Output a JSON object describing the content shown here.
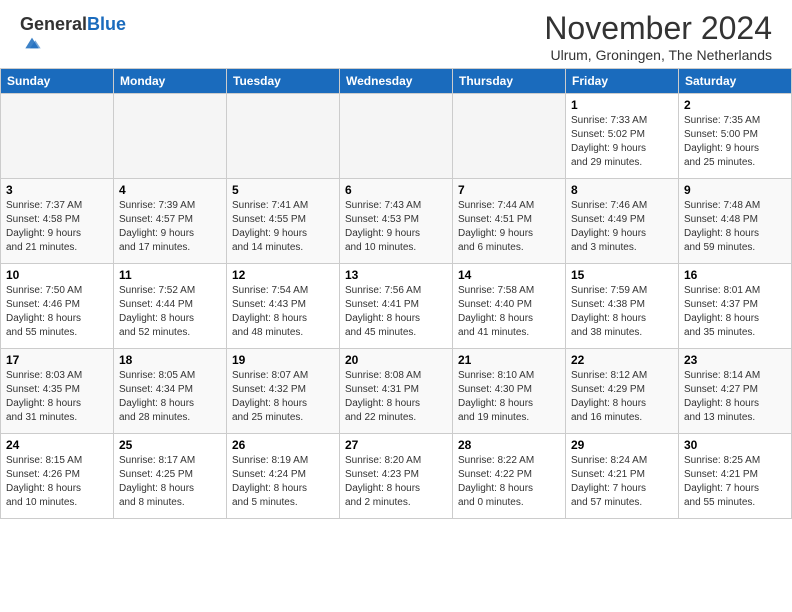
{
  "header": {
    "logo_general": "General",
    "logo_blue": "Blue",
    "month_title": "November 2024",
    "subtitle": "Ulrum, Groningen, The Netherlands"
  },
  "calendar": {
    "days_of_week": [
      "Sunday",
      "Monday",
      "Tuesday",
      "Wednesday",
      "Thursday",
      "Friday",
      "Saturday"
    ],
    "weeks": [
      [
        {
          "day": "",
          "info": ""
        },
        {
          "day": "",
          "info": ""
        },
        {
          "day": "",
          "info": ""
        },
        {
          "day": "",
          "info": ""
        },
        {
          "day": "",
          "info": ""
        },
        {
          "day": "1",
          "info": "Sunrise: 7:33 AM\nSunset: 5:02 PM\nDaylight: 9 hours\nand 29 minutes."
        },
        {
          "day": "2",
          "info": "Sunrise: 7:35 AM\nSunset: 5:00 PM\nDaylight: 9 hours\nand 25 minutes."
        }
      ],
      [
        {
          "day": "3",
          "info": "Sunrise: 7:37 AM\nSunset: 4:58 PM\nDaylight: 9 hours\nand 21 minutes."
        },
        {
          "day": "4",
          "info": "Sunrise: 7:39 AM\nSunset: 4:57 PM\nDaylight: 9 hours\nand 17 minutes."
        },
        {
          "day": "5",
          "info": "Sunrise: 7:41 AM\nSunset: 4:55 PM\nDaylight: 9 hours\nand 14 minutes."
        },
        {
          "day": "6",
          "info": "Sunrise: 7:43 AM\nSunset: 4:53 PM\nDaylight: 9 hours\nand 10 minutes."
        },
        {
          "day": "7",
          "info": "Sunrise: 7:44 AM\nSunset: 4:51 PM\nDaylight: 9 hours\nand 6 minutes."
        },
        {
          "day": "8",
          "info": "Sunrise: 7:46 AM\nSunset: 4:49 PM\nDaylight: 9 hours\nand 3 minutes."
        },
        {
          "day": "9",
          "info": "Sunrise: 7:48 AM\nSunset: 4:48 PM\nDaylight: 8 hours\nand 59 minutes."
        }
      ],
      [
        {
          "day": "10",
          "info": "Sunrise: 7:50 AM\nSunset: 4:46 PM\nDaylight: 8 hours\nand 55 minutes."
        },
        {
          "day": "11",
          "info": "Sunrise: 7:52 AM\nSunset: 4:44 PM\nDaylight: 8 hours\nand 52 minutes."
        },
        {
          "day": "12",
          "info": "Sunrise: 7:54 AM\nSunset: 4:43 PM\nDaylight: 8 hours\nand 48 minutes."
        },
        {
          "day": "13",
          "info": "Sunrise: 7:56 AM\nSunset: 4:41 PM\nDaylight: 8 hours\nand 45 minutes."
        },
        {
          "day": "14",
          "info": "Sunrise: 7:58 AM\nSunset: 4:40 PM\nDaylight: 8 hours\nand 41 minutes."
        },
        {
          "day": "15",
          "info": "Sunrise: 7:59 AM\nSunset: 4:38 PM\nDaylight: 8 hours\nand 38 minutes."
        },
        {
          "day": "16",
          "info": "Sunrise: 8:01 AM\nSunset: 4:37 PM\nDaylight: 8 hours\nand 35 minutes."
        }
      ],
      [
        {
          "day": "17",
          "info": "Sunrise: 8:03 AM\nSunset: 4:35 PM\nDaylight: 8 hours\nand 31 minutes."
        },
        {
          "day": "18",
          "info": "Sunrise: 8:05 AM\nSunset: 4:34 PM\nDaylight: 8 hours\nand 28 minutes."
        },
        {
          "day": "19",
          "info": "Sunrise: 8:07 AM\nSunset: 4:32 PM\nDaylight: 8 hours\nand 25 minutes."
        },
        {
          "day": "20",
          "info": "Sunrise: 8:08 AM\nSunset: 4:31 PM\nDaylight: 8 hours\nand 22 minutes."
        },
        {
          "day": "21",
          "info": "Sunrise: 8:10 AM\nSunset: 4:30 PM\nDaylight: 8 hours\nand 19 minutes."
        },
        {
          "day": "22",
          "info": "Sunrise: 8:12 AM\nSunset: 4:29 PM\nDaylight: 8 hours\nand 16 minutes."
        },
        {
          "day": "23",
          "info": "Sunrise: 8:14 AM\nSunset: 4:27 PM\nDaylight: 8 hours\nand 13 minutes."
        }
      ],
      [
        {
          "day": "24",
          "info": "Sunrise: 8:15 AM\nSunset: 4:26 PM\nDaylight: 8 hours\nand 10 minutes."
        },
        {
          "day": "25",
          "info": "Sunrise: 8:17 AM\nSunset: 4:25 PM\nDaylight: 8 hours\nand 8 minutes."
        },
        {
          "day": "26",
          "info": "Sunrise: 8:19 AM\nSunset: 4:24 PM\nDaylight: 8 hours\nand 5 minutes."
        },
        {
          "day": "27",
          "info": "Sunrise: 8:20 AM\nSunset: 4:23 PM\nDaylight: 8 hours\nand 2 minutes."
        },
        {
          "day": "28",
          "info": "Sunrise: 8:22 AM\nSunset: 4:22 PM\nDaylight: 8 hours\nand 0 minutes."
        },
        {
          "day": "29",
          "info": "Sunrise: 8:24 AM\nSunset: 4:21 PM\nDaylight: 7 hours\nand 57 minutes."
        },
        {
          "day": "30",
          "info": "Sunrise: 8:25 AM\nSunset: 4:21 PM\nDaylight: 7 hours\nand 55 minutes."
        }
      ]
    ]
  }
}
